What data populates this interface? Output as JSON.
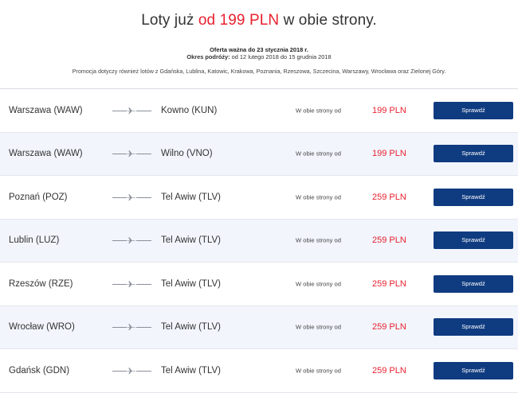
{
  "header": {
    "headline_pre": "Loty już ",
    "headline_price": "od 199 PLN",
    "headline_post": " w obie strony.",
    "offer": "Oferta ważna do 23 stycznia 2018 r.",
    "period_label": "Okres podróży:",
    "period_value": " od 12 lutego 2018 do 15 grudnia 2018",
    "promo": "Promocja dotyczy również lotów z Gdańska, Lublina, Katowic, Krakowa, Poznania, Rzeszowa, Szczecina, Warszawy, Wrocława oraz Zielonej Góry."
  },
  "colors": {
    "accent": "#e8212f",
    "button": "#0f3b80",
    "alt_row": "#f2f5fc"
  },
  "rows": [
    {
      "from": "Warszawa (WAW)",
      "to": "Kowno (KUN)",
      "label": "W obie strony od",
      "price": "199 PLN",
      "button": "Sprawdź"
    },
    {
      "from": "Warszawa (WAW)",
      "to": "Wilno (VNO)",
      "label": "W obie strony od",
      "price": "199 PLN",
      "button": "Sprawdź"
    },
    {
      "from": "Poznań (POZ)",
      "to": "Tel Awiw (TLV)",
      "label": "W obie strony od",
      "price": "259 PLN",
      "button": "Sprawdź"
    },
    {
      "from": "Lublin (LUZ)",
      "to": "Tel Awiw (TLV)",
      "label": "W obie strony od",
      "price": "259 PLN",
      "button": "Sprawdź"
    },
    {
      "from": "Rzeszów (RZE)",
      "to": "Tel Awiw (TLV)",
      "label": "W obie strony od",
      "price": "259 PLN",
      "button": "Sprawdź"
    },
    {
      "from": "Wrocław (WRO)",
      "to": "Tel Awiw (TLV)",
      "label": "W obie strony od",
      "price": "259 PLN",
      "button": "Sprawdź"
    },
    {
      "from": "Gdańsk (GDN)",
      "to": "Tel Awiw (TLV)",
      "label": "W obie strony od",
      "price": "259 PLN",
      "button": "Sprawdź"
    }
  ]
}
